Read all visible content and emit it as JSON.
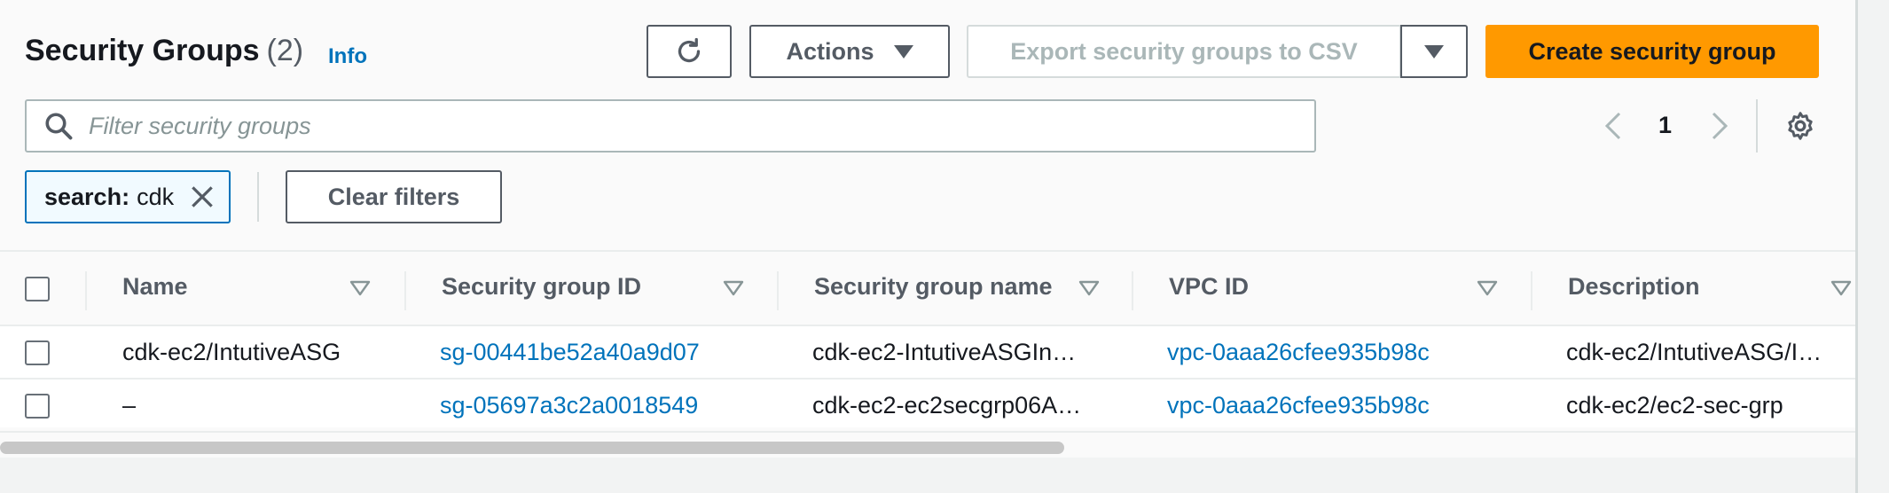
{
  "header": {
    "title": "Security Groups",
    "count": "(2)",
    "info_link": "Info"
  },
  "toolbar": {
    "refresh_icon": "refresh-icon",
    "actions_label": "Actions",
    "export_label": "Export security groups to CSV",
    "create_label": "Create security group"
  },
  "filter": {
    "placeholder": "Filter security groups",
    "token_key": "search:",
    "token_value": "cdk",
    "clear_label": "Clear filters"
  },
  "pagination": {
    "current_page": "1"
  },
  "table": {
    "columns": [
      "Name",
      "Security group ID",
      "Security group name",
      "VPC ID",
      "Description"
    ],
    "rows": [
      {
        "name": "cdk-ec2/IntutiveASG",
        "sg_id": "sg-00441be52a40a9d07",
        "sg_name": "cdk-ec2-IntutiveASGIn…",
        "vpc_id": "vpc-0aaa26cfee935b98c",
        "description": "cdk-ec2/IntutiveASG/I…"
      },
      {
        "name": "–",
        "sg_id": "sg-05697a3c2a0018549",
        "sg_name": "cdk-ec2-ec2secgrp06A…",
        "vpc_id": "vpc-0aaa26cfee935b98c",
        "description": "cdk-ec2/ec2-sec-grp"
      }
    ]
  },
  "colors": {
    "primary": "#ff9900",
    "link": "#0073bb"
  }
}
